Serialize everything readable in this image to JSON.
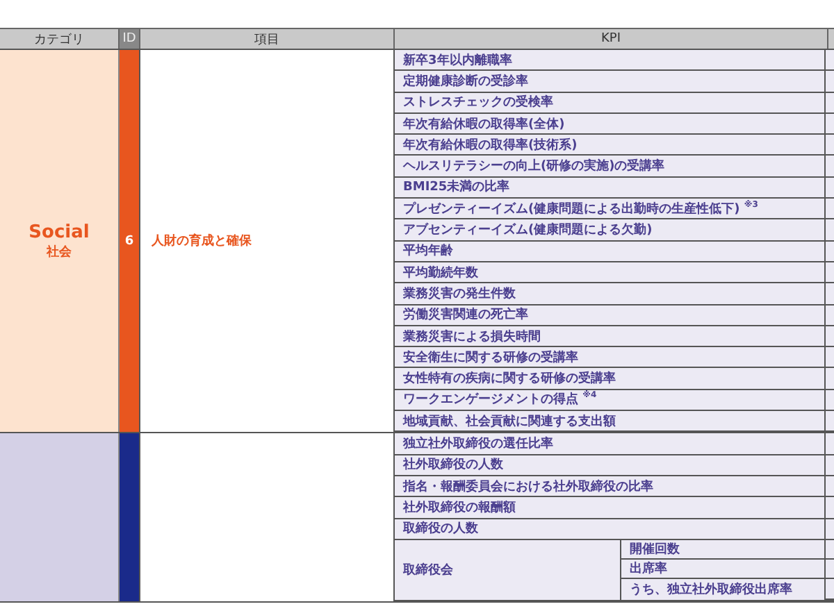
{
  "table": {
    "columns": [
      "カテゴリ",
      "ID",
      "項目",
      "KPI"
    ],
    "sections": [
      {
        "category": "Social",
        "category_sub": "社会",
        "id": "6",
        "item": "人財の育成と確保",
        "color": "#e8561f",
        "kpis": [
          {
            "kind": "single",
            "label": "新卒3年以内離職率"
          },
          {
            "kind": "single",
            "label": "定期健康診断の受診率"
          },
          {
            "kind": "single",
            "label": "ストレスチェックの受検率"
          },
          {
            "kind": "single",
            "label": "年次有給休暇の取得率(全体)"
          },
          {
            "kind": "single",
            "label": "年次有給休暇の取得率(技術系)"
          },
          {
            "kind": "single",
            "label": "ヘルスリテラシーの向上(研修の実施)の受講率"
          },
          {
            "kind": "single",
            "label": "BMI25未満の比率"
          },
          {
            "kind": "single",
            "label": "プレゼンティーイズム(健康問題による出勤時の生産性低下) $^{※3}$"
          },
          {
            "kind": "single",
            "label": "アブセンティーイズム(健康問題による欠勤)"
          },
          {
            "kind": "single",
            "label": "平均年齢"
          },
          {
            "kind": "single",
            "label": "平均勤続年数"
          },
          {
            "kind": "single",
            "label": "業務災害の発生件数"
          },
          {
            "kind": "single",
            "label": "労働災害関連の死亡率"
          },
          {
            "kind": "single",
            "label": "業務災害による損失時間"
          },
          {
            "kind": "single",
            "label": "安全衛生に関する研修の受講率"
          },
          {
            "kind": "single",
            "label": "女性特有の疾病に関する研修の受講率"
          },
          {
            "kind": "single",
            "label": "ワークエンゲージメントの得点 $^{※4}$"
          },
          {
            "kind": "single",
            "label": "地域貢献、社会貢献に関連する支出額"
          }
        ]
      },
      {
        "color": "#1a2a8a",
        "kpis": [
          {
            "kind": "single",
            "label": "独立社外取締役の選任比率"
          },
          {
            "kind": "single",
            "label": "社外取締役の人数"
          },
          {
            "kind": "single",
            "label": "指名・報酬委員会における社外取締役の比率"
          },
          {
            "kind": "single",
            "label": "社外取締役の報酬額"
          },
          {
            "kind": "single",
            "label": "取締役の人数"
          },
          {
            "kind": "group",
            "label": "取締役会",
            "subs": [
              "開催回数",
              "出席率",
              "うち、独立社外取締役出席率"
            ]
          }
        ]
      }
    ]
  }
}
